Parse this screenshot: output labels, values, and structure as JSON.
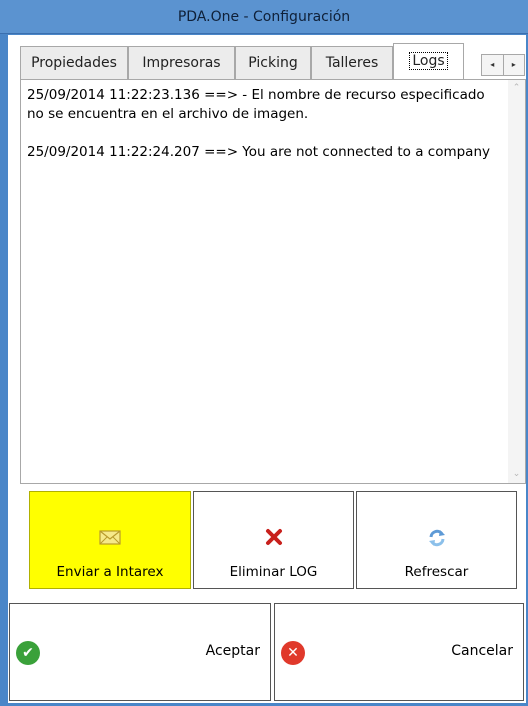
{
  "window": {
    "title": "PDA.One - Configuración"
  },
  "tabs": [
    {
      "label": "Propiedades"
    },
    {
      "label": "Impresoras"
    },
    {
      "label": "Picking"
    },
    {
      "label": "Talleres"
    },
    {
      "label": "Logs"
    }
  ],
  "active_tab": "Logs",
  "tab_scroll": {
    "left": "◂",
    "right": "▸"
  },
  "log": {
    "entries": [
      "25/09/2014 11:22:23.136 ==> - El nombre de recurso especificado no se encuentra en el archivo de imagen.",
      "25/09/2014 11:22:24.207 ==> You are not connected to a company"
    ],
    "scroll_up": "⌃",
    "scroll_down": "⌄"
  },
  "actions": {
    "send": {
      "label": "Enviar a Intarex",
      "icon": "envelope-icon",
      "color": "#ffff00"
    },
    "delete": {
      "label": "Eliminar LOG",
      "icon": "red-x-icon"
    },
    "refresh": {
      "label": "Refrescar",
      "icon": "refresh-icon"
    }
  },
  "footer": {
    "accept": {
      "label": "Aceptar",
      "icon": "green-check-icon",
      "color": "#3aa13a"
    },
    "cancel": {
      "label": "Cancelar",
      "icon": "red-x-circle-icon",
      "color": "#e0392b"
    }
  }
}
